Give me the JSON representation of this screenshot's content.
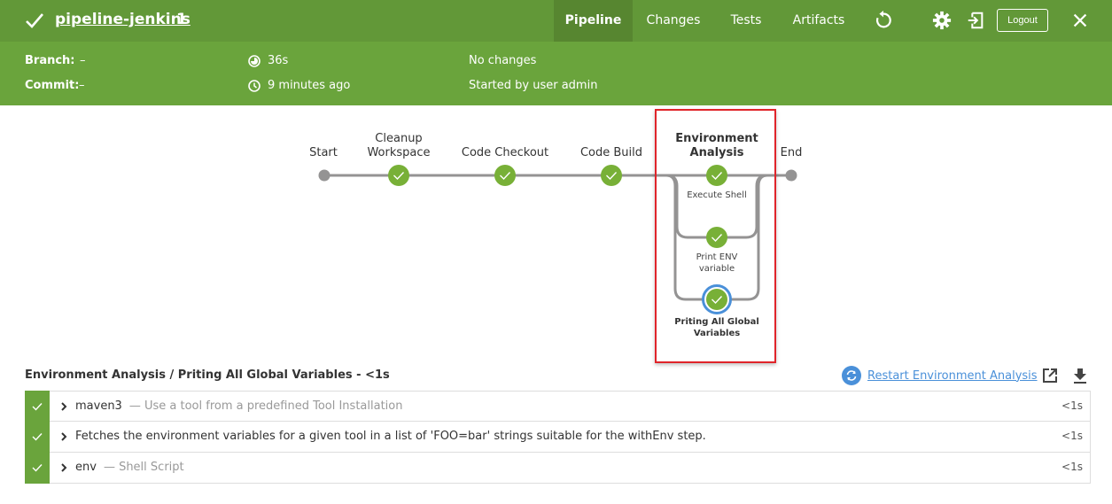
{
  "header": {
    "status_icon": "check-icon",
    "title": "pipeline-jenkins",
    "run_number": "1",
    "tabs": [
      {
        "label": "Pipeline",
        "active": true
      },
      {
        "label": "Changes",
        "active": false
      },
      {
        "label": "Tests",
        "active": false
      },
      {
        "label": "Artifacts",
        "active": false
      }
    ],
    "logout_label": "Logout",
    "icons": [
      "replay-icon",
      "gear-icon",
      "exit-icon",
      "close-icon"
    ]
  },
  "summary": {
    "branch_label": "Branch:",
    "branch_value": "–",
    "commit_label": "Commit:",
    "commit_value": "–",
    "duration": "36s",
    "started_ago": "9 minutes ago",
    "changes": "No changes",
    "started_by": "Started by user admin"
  },
  "pipeline": {
    "stages": [
      {
        "label": "Start",
        "type": "start"
      },
      {
        "label": "Cleanup Workspace",
        "status": "success"
      },
      {
        "label": "Code Checkout",
        "status": "success"
      },
      {
        "label": "Code Build",
        "status": "success"
      },
      {
        "label": "Environment Analysis",
        "status": "success",
        "selected": true,
        "parallel": [
          {
            "label": "Execute Shell",
            "status": "success"
          },
          {
            "label": "Print ENV variable",
            "status": "success"
          },
          {
            "label": "Priting All Global Variables",
            "status": "success",
            "selected": true
          }
        ]
      },
      {
        "label": "End",
        "type": "end"
      }
    ]
  },
  "details": {
    "title": "Environment Analysis / Priting All Global Variables - <1s",
    "restart_label": "Restart Environment Analysis",
    "steps": [
      {
        "name": "maven3",
        "description": "— Use a tool from a predefined Tool Installation",
        "duration": "<1s",
        "status": "success"
      },
      {
        "name": "Fetches the environment variables for a given tool in a list of 'FOO=bar' strings suitable for the withEnv step.",
        "description": "",
        "duration": "<1s",
        "status": "success"
      },
      {
        "name": "env",
        "description": "— Shell Script",
        "duration": "<1s",
        "status": "success"
      }
    ]
  },
  "colors": {
    "header_bg": "#629838",
    "subheader_bg": "#6aa43c",
    "success": "#78b037",
    "selected_ring": "#4a90d9",
    "highlight_border": "#e0242a",
    "link": "#4a90d9"
  }
}
